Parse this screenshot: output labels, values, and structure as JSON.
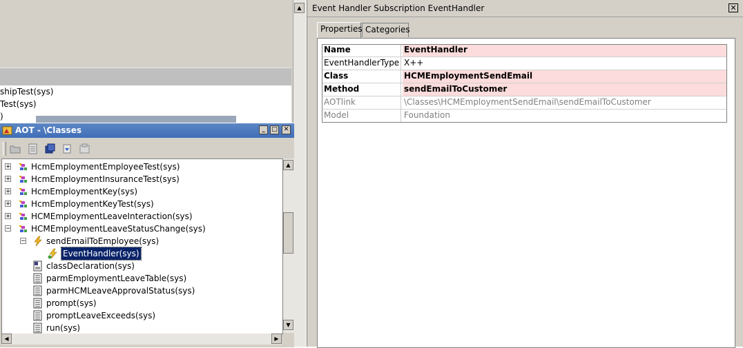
{
  "background": {
    "lines": [
      "shipTest(sys)",
      "Test(sys)",
      ")"
    ]
  },
  "aot": {
    "title": "AOT - \\Classes",
    "min_label": "_",
    "max_label": "□",
    "close_label": "✕",
    "tree": [
      {
        "label": "HcmEmploymentEmployeeTest(sys)",
        "expander": "+",
        "icon": "class-icon",
        "level": 0
      },
      {
        "label": "HcmEmploymentInsuranceTest(sys)",
        "expander": "+",
        "icon": "class-icon",
        "level": 0
      },
      {
        "label": "HcmEmploymentKey(sys)",
        "expander": "+",
        "icon": "class-icon",
        "level": 0
      },
      {
        "label": "HcmEmploymentKeyTest(sys)",
        "expander": "+",
        "icon": "class-icon",
        "level": 0
      },
      {
        "label": "HCMEmploymentLeaveInteraction(sys)",
        "expander": "+",
        "icon": "class-icon",
        "level": 0
      },
      {
        "label": "HCMEmploymentLeaveStatusChange(sys)",
        "expander": "−",
        "icon": "class-icon",
        "level": 0
      },
      {
        "label": "sendEmailToEmployee(sys)",
        "expander": "−",
        "icon": "method-event-icon",
        "level": 1
      },
      {
        "label": "EventHandler(sys)",
        "expander": "",
        "icon": "event-handler-icon",
        "level": 2,
        "selected": true
      },
      {
        "label": "classDeclaration(sys)",
        "expander": "",
        "icon": "class-declaration-icon",
        "level": 1
      },
      {
        "label": "parmEmploymentLeaveTable(sys)",
        "expander": "",
        "icon": "method-icon",
        "level": 1
      },
      {
        "label": "parmHCMLeaveApprovalStatus(sys)",
        "expander": "",
        "icon": "method-icon",
        "level": 1
      },
      {
        "label": "prompt(sys)",
        "expander": "",
        "icon": "method-icon",
        "level": 1
      },
      {
        "label": "promptLeaveExceeds(sys)",
        "expander": "",
        "icon": "method-icon",
        "level": 1
      },
      {
        "label": "run(sys)",
        "expander": "",
        "icon": "method-icon",
        "level": 1
      }
    ]
  },
  "properties_window": {
    "title": "Event Handler Subscription EventHandler",
    "close_label": "✕",
    "tabs": [
      {
        "label": "Properties",
        "active": true
      },
      {
        "label": "Categories",
        "active": false
      }
    ],
    "rows": [
      {
        "name": "Name",
        "value": "EventHandler",
        "bold": true,
        "pink": true,
        "readonly": false
      },
      {
        "name": "EventHandlerType",
        "value": "X++",
        "bold": false,
        "pink": false,
        "readonly": false
      },
      {
        "name": "Class",
        "value": "HCMEmploymentSendEmail",
        "bold": true,
        "pink": true,
        "readonly": false
      },
      {
        "name": "Method",
        "value": "sendEmailToCustomer",
        "bold": true,
        "pink": true,
        "readonly": false
      },
      {
        "name": "AOTlink",
        "value": "\\Classes\\HCMEmploymentSendEmail\\sendEmailToCustomer",
        "bold": false,
        "pink": false,
        "readonly": true
      },
      {
        "name": "Model",
        "value": "Foundation",
        "bold": false,
        "pink": false,
        "readonly": true
      }
    ]
  },
  "colors": {
    "required_highlight": "#fcdcdc",
    "selection": "#0a246a",
    "title_bar": "#3f6eb8"
  }
}
